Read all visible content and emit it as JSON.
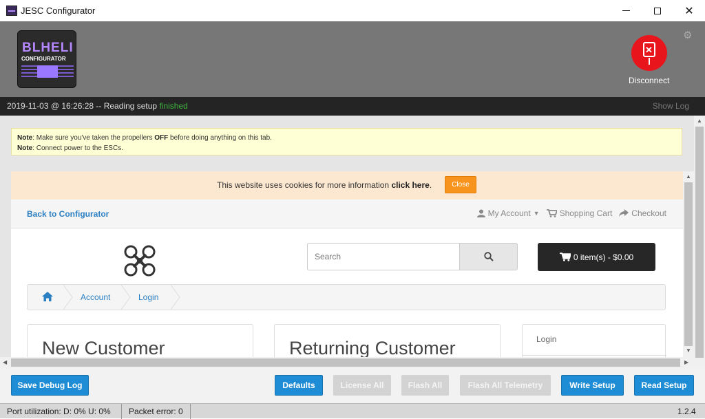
{
  "window": {
    "title": "JESC Configurator",
    "min_label": "",
    "max_label": "",
    "close_label": "✕"
  },
  "header": {
    "logo_line1": "BLHELI",
    "logo_line2": "CONFIGURATOR",
    "disconnect_label": "Disconnect",
    "gear_glyph": "⚙"
  },
  "log": {
    "text": "2019-11-03 @ 16:26:28 -- Reading setup ",
    "status": "finished",
    "show_log": "Show Log"
  },
  "notes": {
    "label1": "Note",
    "text1_pre": ": Make sure you've taken the propellers ",
    "text1_bold": "OFF",
    "text1_post": " before doing anything on this tab.",
    "label2": "Note",
    "text2": ": Connect power to the ESCs."
  },
  "web": {
    "cookie_text": "This website uses cookies for more information ",
    "cookie_link": "click here",
    "cookie_period": ".",
    "cookie_close": "Close",
    "back_link": "Back to Configurator",
    "my_account": "My Account",
    "shopping_cart": "Shopping Cart",
    "checkout": "Checkout",
    "search_placeholder": "Search",
    "cart_label": "0 item(s) - $0.00",
    "breadcrumb": [
      "Account",
      "Login"
    ],
    "new_customer": "New Customer",
    "returning_customer": "Returning Customer",
    "side_login": "Login"
  },
  "buttons": {
    "save_debug_log": "Save Debug Log",
    "defaults": "Defaults",
    "license_all": "License All",
    "flash_all": "Flash All",
    "flash_all_telemetry": "Flash All Telemetry",
    "write_setup": "Write Setup",
    "read_setup": "Read Setup"
  },
  "status": {
    "port_utilization": "Port utilization: D: 0% U: 0%",
    "packet_error": "Packet error: 0",
    "version": "1.2.4"
  },
  "colors": {
    "accent_blue": "#1f8dd6",
    "disconnect_red": "#e8151c",
    "log_finished": "#3fb63f",
    "cookie_orange": "#f7941d"
  }
}
